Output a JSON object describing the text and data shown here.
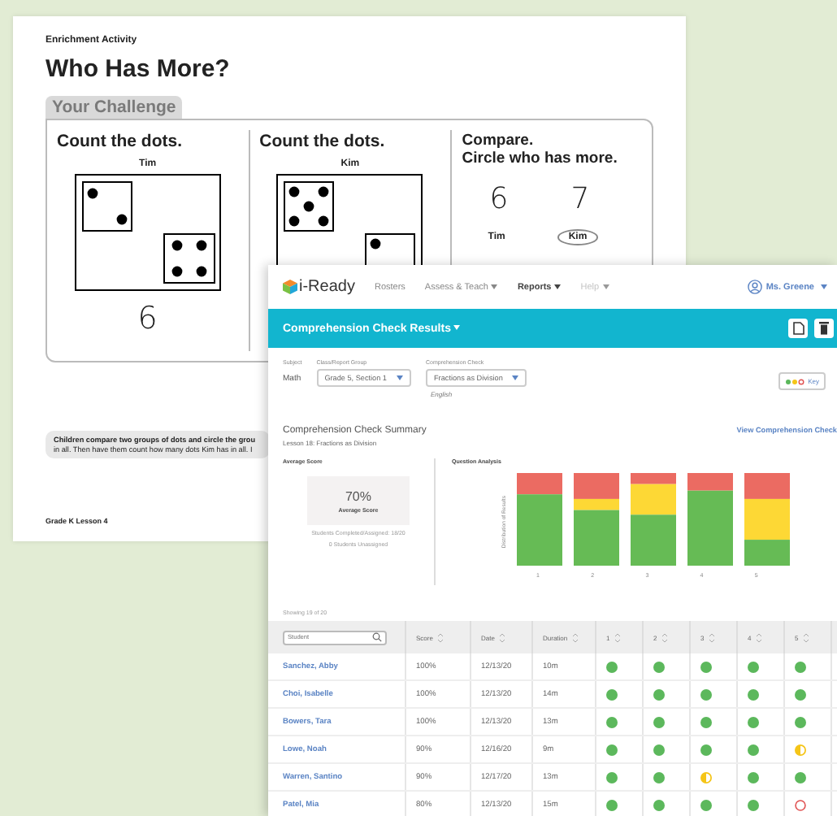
{
  "worksheet": {
    "eyebrow": "Enrichment Activity",
    "title": "Who Has More?",
    "challenge_tab": "Your Challenge",
    "panels": [
      {
        "kind": "count",
        "heading": "Count the dots.",
        "name": "Tim",
        "answer": "6"
      },
      {
        "kind": "count",
        "heading": "Count the dots.",
        "name": "Kim"
      },
      {
        "kind": "compare",
        "heading_lines": [
          "Compare.",
          "Circle who has more."
        ],
        "numbers": [
          "6",
          "7"
        ],
        "names": [
          {
            "label": "Tim",
            "selected": false
          },
          {
            "label": "Kim",
            "selected": true
          }
        ]
      }
    ],
    "note": [
      "Children compare two groups of dots and circle the grou",
      "in all. Then have them count how many dots Kim has in all. I"
    ],
    "footer": "Grade K  Lesson 4"
  },
  "app": {
    "nav": {
      "logo": "i-Ready",
      "items": [
        {
          "label": "Rosters",
          "menu": false,
          "selected": false,
          "disabled": false
        },
        {
          "label": "Assess & Teach",
          "menu": true,
          "selected": false,
          "disabled": false
        },
        {
          "label": "Reports",
          "menu": true,
          "selected": true,
          "disabled": false
        },
        {
          "label": "Help",
          "menu": true,
          "selected": false,
          "disabled": true
        }
      ],
      "user": "Ms. Greene"
    },
    "header": {
      "title": "Comprehension Check Results"
    },
    "filters": {
      "subject_label": "Subject",
      "subject": "Math",
      "group_label": "Class/Report Group",
      "group": "Grade 5, Section 1",
      "check_label": "Comprehension Check",
      "check": "Fractions as Division",
      "language": "English",
      "key_button": "Key"
    },
    "summary": {
      "title": "Comprehension Check Summary",
      "subtitle": "Lesson 18: Fractions as Division",
      "link": "View Comprehension Check",
      "average_label": "Average Score",
      "average_value": "70%",
      "average_caption": "Average Score",
      "completed": "Students Completed/Assigned: 18/20",
      "unassigned": "0 Students Unassigned",
      "analysis_label": "Question Analysis",
      "y_axis_label": "Distribution of Results",
      "questions": [
        "1",
        "2",
        "3",
        "4",
        "5"
      ]
    },
    "table": {
      "showing": "Showing 19 of 20",
      "search_placeholder": "Student",
      "columns": [
        "Score",
        "Date",
        "Duration",
        "1",
        "2",
        "3",
        "4",
        "5"
      ],
      "rows": [
        {
          "name": "Sanchez, Abby",
          "score": "100%",
          "date": "12/13/20",
          "duration": "10m",
          "results": [
            {
              "kind": "correct"
            },
            {
              "kind": "correct"
            },
            {
              "kind": "correct"
            },
            {
              "kind": "correct"
            },
            {
              "kind": "correct"
            }
          ]
        },
        {
          "name": "Choi, Isabelle",
          "score": "100%",
          "date": "12/13/20",
          "duration": "14m",
          "results": [
            {
              "kind": "correct"
            },
            {
              "kind": "correct"
            },
            {
              "kind": "correct"
            },
            {
              "kind": "correct"
            },
            {
              "kind": "correct"
            }
          ]
        },
        {
          "name": "Bowers, Tara",
          "score": "100%",
          "date": "12/13/20",
          "duration": "13m",
          "results": [
            {
              "kind": "correct"
            },
            {
              "kind": "correct"
            },
            {
              "kind": "correct"
            },
            {
              "kind": "correct"
            },
            {
              "kind": "correct"
            }
          ]
        },
        {
          "name": "Lowe, Noah",
          "score": "90%",
          "date": "12/16/20",
          "duration": "9m",
          "results": [
            {
              "kind": "correct"
            },
            {
              "kind": "correct"
            },
            {
              "kind": "correct"
            },
            {
              "kind": "correct"
            },
            {
              "kind": "partial"
            }
          ]
        },
        {
          "name": "Warren, Santino",
          "score": "90%",
          "date": "12/17/20",
          "duration": "13m",
          "results": [
            {
              "kind": "correct"
            },
            {
              "kind": "correct"
            },
            {
              "kind": "partial"
            },
            {
              "kind": "correct"
            },
            {
              "kind": "correct"
            }
          ]
        },
        {
          "name": "Patel, Mia",
          "score": "80%",
          "date": "12/13/20",
          "duration": "15m",
          "results": [
            {
              "kind": "correct"
            },
            {
              "kind": "correct"
            },
            {
              "kind": "correct"
            },
            {
              "kind": "correct"
            },
            {
              "kind": "incorrect"
            }
          ]
        }
      ]
    }
  }
}
